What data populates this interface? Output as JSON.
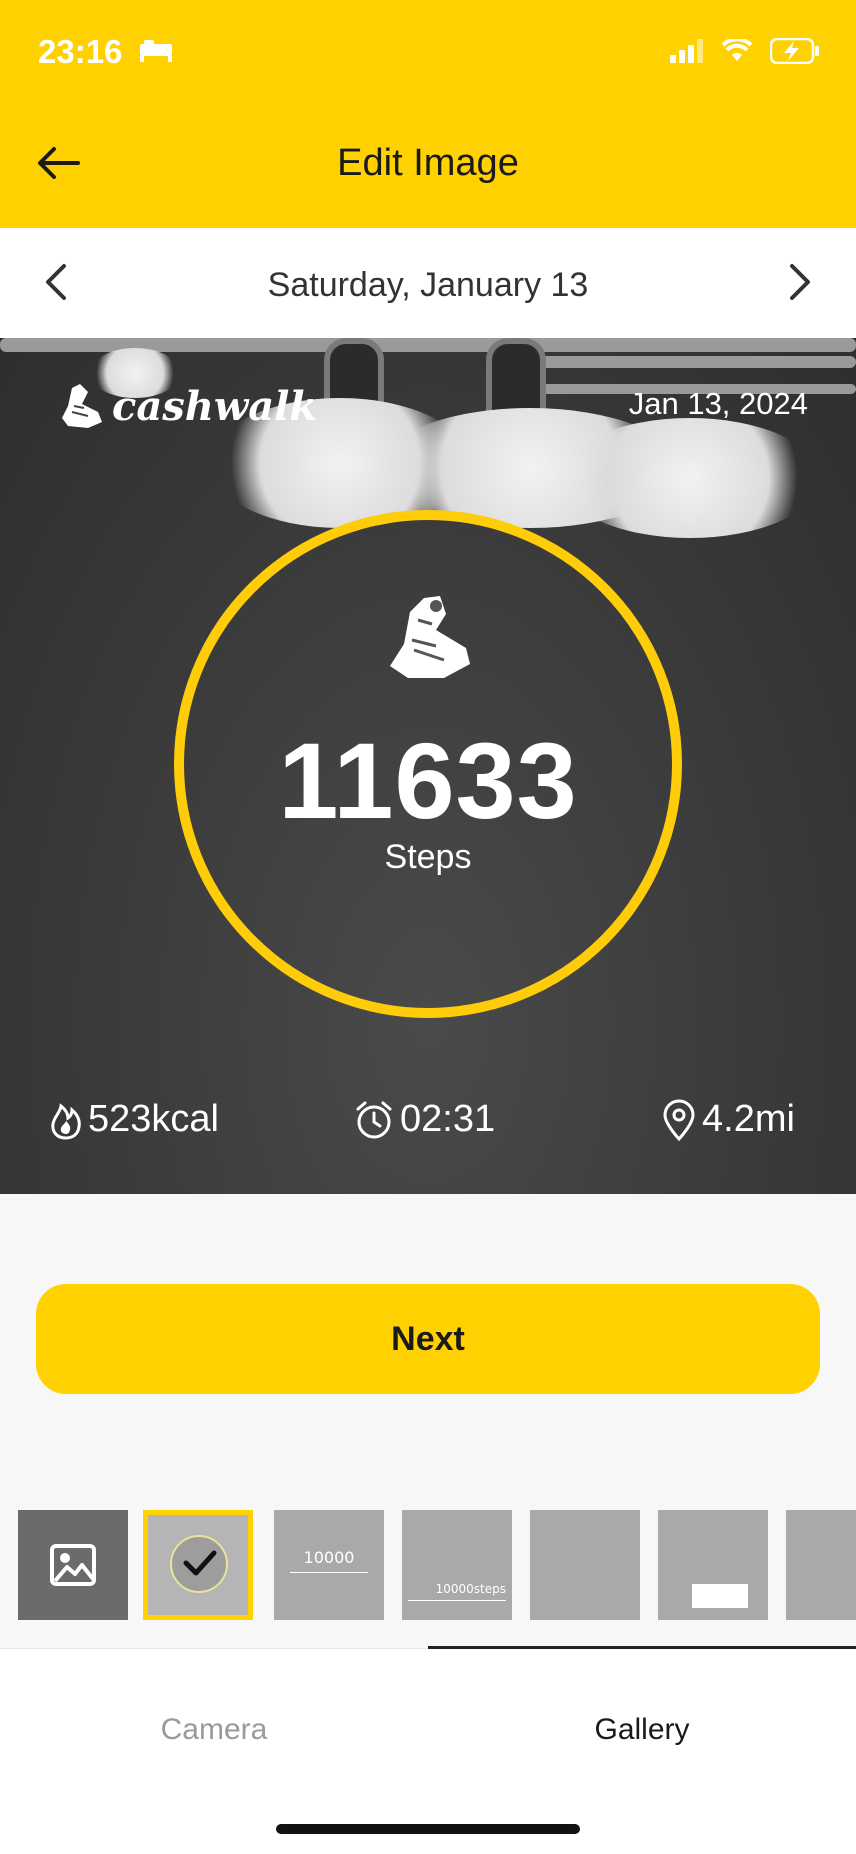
{
  "status_bar": {
    "time": "23:16"
  },
  "header": {
    "title": "Edit Image"
  },
  "date_nav": {
    "label": "Saturday, January 13"
  },
  "photo": {
    "brand": "cashwalk",
    "date": "Jan 13, 2024",
    "steps": "11633",
    "steps_label": "Steps",
    "calories": "523kcal",
    "duration": "02:31",
    "distance": "4.2mi"
  },
  "actions": {
    "next_label": "Next"
  },
  "templates": {
    "thumb2_value": "10000",
    "thumb3_value": "10000steps"
  },
  "tabs": {
    "camera": "Camera",
    "gallery": "Gallery",
    "active": "Gallery"
  },
  "colors": {
    "accent": "#ffd100",
    "ring": "#ffcc0a"
  }
}
